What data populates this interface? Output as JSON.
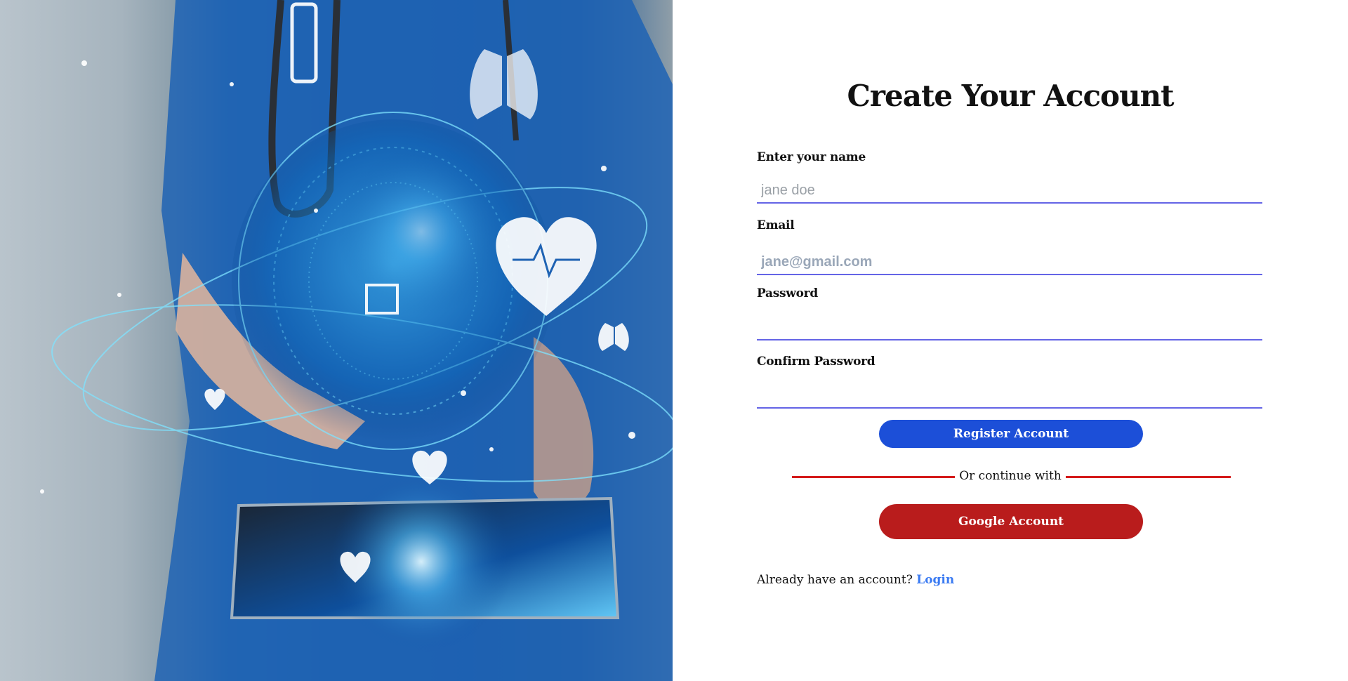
{
  "form": {
    "title": "Create Your Account",
    "fields": [
      {
        "label": "Enter your name",
        "placeholder": "jane doe",
        "value": ""
      },
      {
        "label": "Email",
        "placeholder": "jane@gmail.com",
        "value": ""
      },
      {
        "label": "Password",
        "placeholder": "",
        "value": ""
      },
      {
        "label": "Confirm Password",
        "placeholder": "",
        "value": ""
      }
    ],
    "register_label": "Register Account",
    "divider_text": "Or continue with",
    "google_label": "Google Account",
    "footer_text": "Already have an account?",
    "login_link": "Login"
  },
  "colors": {
    "input_underline": "#6464e6",
    "register_button": "#1c4fd8",
    "google_button": "#b91c1c",
    "divider": "#d41a1a",
    "link": "#3b7bf2"
  },
  "hero": {
    "icons": [
      "stethoscope",
      "smartphone-icon",
      "heart-icon",
      "lungs-icon",
      "tablet-device"
    ]
  }
}
